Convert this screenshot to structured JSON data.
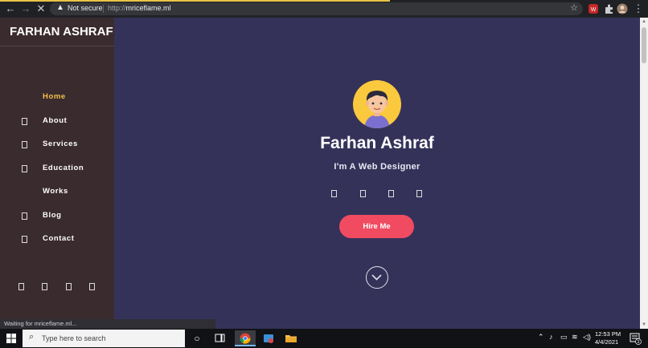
{
  "browser": {
    "security_label": "Not secure",
    "url_scheme": "http://",
    "url_host": "mriceflame.ml"
  },
  "sidebar": {
    "brand": "FARHAN ASHRAF",
    "items": [
      {
        "label": "Home",
        "active": true,
        "icon": "none"
      },
      {
        "label": "About",
        "active": false,
        "icon": "user-icon"
      },
      {
        "label": "Services",
        "active": false,
        "icon": "briefcase-icon"
      },
      {
        "label": "Education",
        "active": false,
        "icon": "graduation-icon"
      },
      {
        "label": "Works",
        "active": false,
        "icon": "none"
      },
      {
        "label": "Blog",
        "active": false,
        "icon": "blog-icon"
      },
      {
        "label": "Contact",
        "active": false,
        "icon": "envelope-icon"
      }
    ],
    "social_icons": [
      "facebook-icon",
      "twitter-icon",
      "instagram-icon",
      "linkedin-icon"
    ]
  },
  "hero": {
    "name": "Farhan Ashraf",
    "title": "I'm A Web Designer",
    "social_icons": [
      "facebook-icon",
      "twitter-icon",
      "instagram-icon",
      "linkedin-icon"
    ],
    "cta_label": "Hire Me"
  },
  "status_bar": {
    "text": "Waiting for mriceflame.ml..."
  },
  "taskbar": {
    "search_placeholder": "Type here to search",
    "time": "12:53 PM",
    "date": "4/4/2021",
    "notification_count": "3"
  },
  "colors": {
    "main_bg": "#35325a",
    "sidebar_bg": "#3a2b2e",
    "accent": "#f3c14b",
    "cta": "#f14b62"
  }
}
